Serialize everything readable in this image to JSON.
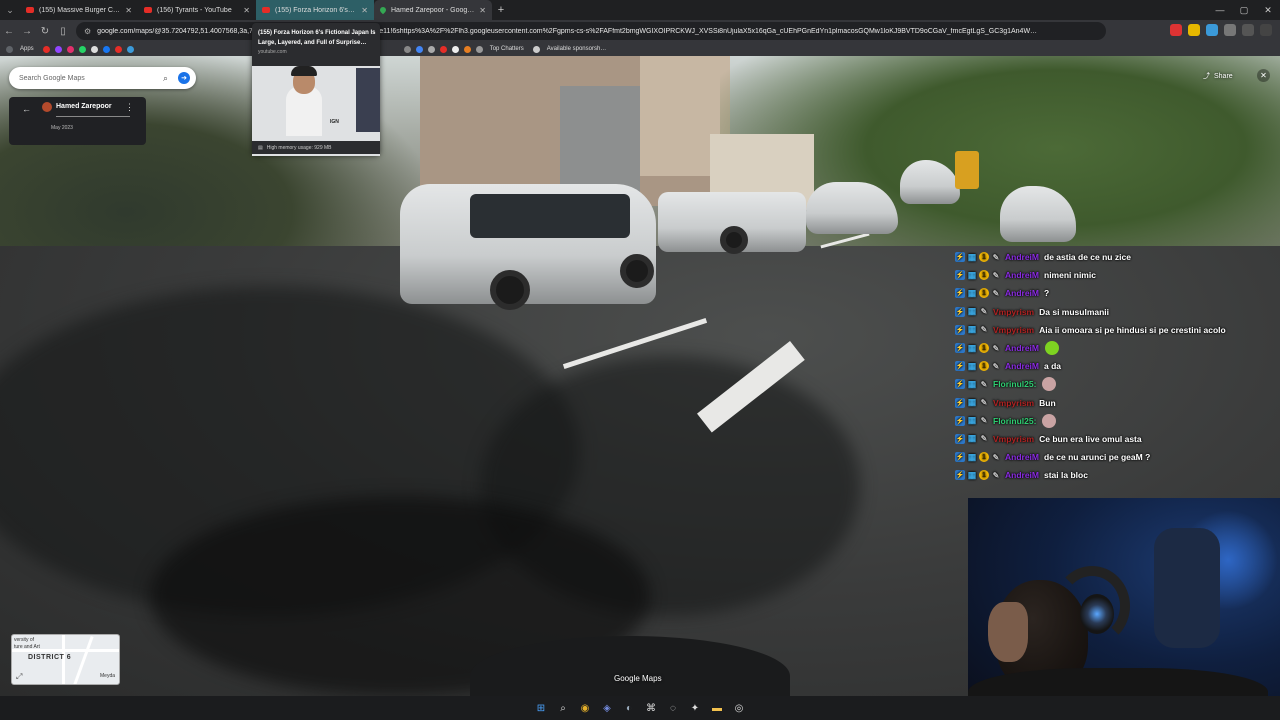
{
  "browser": {
    "tabs": [
      {
        "title": "(155) Massive Burger Crowned"
      },
      {
        "title": "(156) Tyrants - YouTube"
      },
      {
        "title": "(155) Forza Horizon 6's Fiction"
      },
      {
        "title": "Hamed Zarepoor - Google Ma"
      }
    ],
    "url": "google.com/maps/@35.7204792,51.4007568,3a,75y,…HM0ogKEICAgICx6dng3wE!2e10!3e11!6shttps%3A%2F%2Flh3.googleusercontent.com%2Fgpms-cs-s%2FAFfmt2bmgWGIXOIPRCKWJ_XVSSi8nUjulaX5x16qGa_cUEhPGnEdYn1plmacosGQMw1loKJ9BVTD9oCGaV_fmcEgtLgS_GC3g1An4W…",
    "bookmarks": {
      "apps_label": "Apps",
      "top_chatters": "Top Chatters",
      "available": "Available sponsorsh…"
    }
  },
  "hovercard": {
    "title": "(155) Forza Horizon 6's Fictional Japan Is Large, Layered, and Full of Surprise…",
    "domain": "youtube.com",
    "memory": "High memory usage: 929 MB",
    "thumb_logo": "IGN"
  },
  "maps": {
    "search_placeholder": "Search Google Maps",
    "place_name": "Hamed Zarepoor",
    "date": "May 2023",
    "share_label": "Share",
    "watermark": "Google Maps",
    "minimap": {
      "district": "DISTRICT 6",
      "label_top": "versity of",
      "label_top2": "ture and Art",
      "label_right": "Meyda"
    }
  },
  "chat": [
    {
      "user": "AndreiM",
      "user_color": "#8a2be2",
      "coin": true,
      "message": "de astia de ce nu zice"
    },
    {
      "user": "AndreiM",
      "user_color": "#8a2be2",
      "coin": true,
      "message": "nimeni nimic"
    },
    {
      "user": "AndreiM",
      "user_color": "#8a2be2",
      "coin": true,
      "message": "?"
    },
    {
      "user": "Vmpyrism",
      "user_color": "#b22222",
      "coin": false,
      "message": "Da si musulmanii"
    },
    {
      "user": "Vmpyrism",
      "user_color": "#b22222",
      "coin": false,
      "message": "Aia ii omoara si pe hindusi si pe crestini acolo"
    },
    {
      "user": "AndreiM",
      "user_color": "#8a2be2",
      "coin": true,
      "message": "",
      "emote": "#7ed321"
    },
    {
      "user": "AndreiM",
      "user_color": "#8a2be2",
      "coin": true,
      "message": "a da"
    },
    {
      "user": "Florinul25:",
      "user_color": "#2ecc71",
      "coin": false,
      "message": "",
      "emote": "#c9a3a3"
    },
    {
      "user": "Vmpyrism",
      "user_color": "#b22222",
      "coin": false,
      "message": "Bun"
    },
    {
      "user": "Florinul25:",
      "user_color": "#2ecc71",
      "coin": false,
      "message": "",
      "emote": "#c9a3a3"
    },
    {
      "user": "Vmpyrism",
      "user_color": "#b22222",
      "coin": false,
      "message": "Ce bun era live omul asta"
    },
    {
      "user": "AndreiM",
      "user_color": "#8a2be2",
      "coin": true,
      "message": "de ce nu arunci pe geaM ?"
    },
    {
      "user": "AndreiM",
      "user_color": "#8a2be2",
      "coin": true,
      "message": "stai la bloc"
    }
  ]
}
